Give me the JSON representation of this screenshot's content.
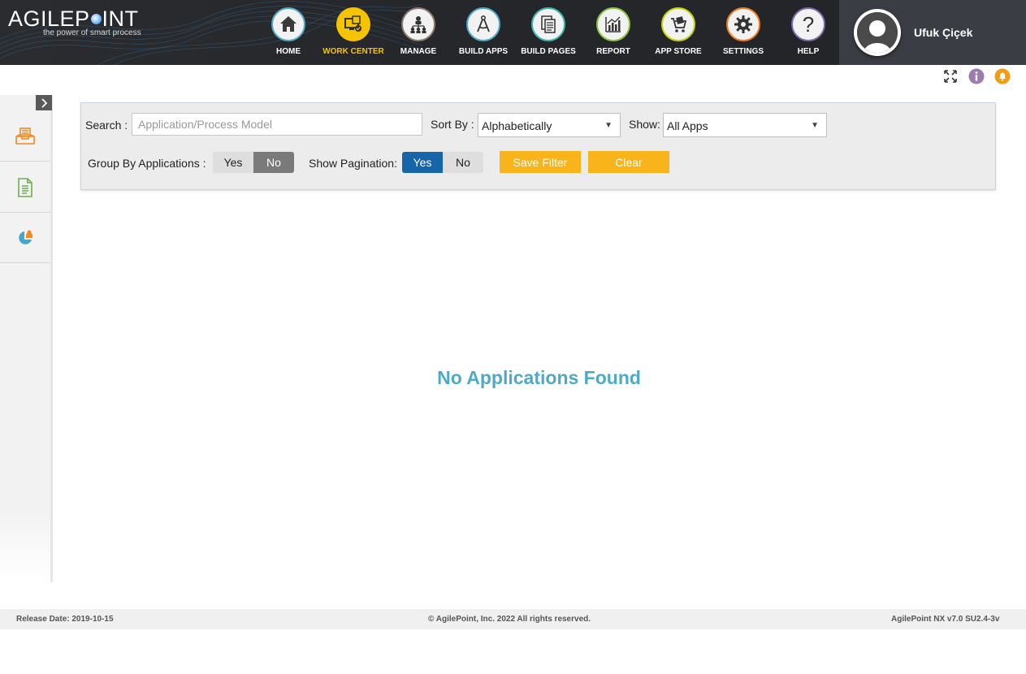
{
  "brand": {
    "name": "AGILEPOINT",
    "tagline": "the power of smart process"
  },
  "nav": [
    {
      "key": "home",
      "label": "HOME",
      "icon": "home-icon",
      "color": "#4eaac6"
    },
    {
      "key": "work-center",
      "label": "WORK CENTER",
      "icon": "work-center-icon",
      "color": "#f5c400",
      "active": true
    },
    {
      "key": "manage",
      "label": "MANAGE",
      "icon": "manage-icon",
      "color": "#8a7a6a"
    },
    {
      "key": "build-apps",
      "label": "BUILD APPS",
      "icon": "build-apps-icon",
      "color": "#4eaac6"
    },
    {
      "key": "build-pages",
      "label": "BUILD PAGES",
      "icon": "build-pages-icon",
      "color": "#3cb6b0"
    },
    {
      "key": "report",
      "label": "REPORT",
      "icon": "report-icon",
      "color": "#8cc63f"
    },
    {
      "key": "app-store",
      "label": "APP STORE",
      "icon": "app-store-icon",
      "color": "#c8d400"
    },
    {
      "key": "settings",
      "label": "SETTINGS",
      "icon": "settings-icon",
      "color": "#f07c1e"
    },
    {
      "key": "help",
      "label": "HELP",
      "icon": "help-icon",
      "color": "#7a6aa8"
    }
  ],
  "user": {
    "name": "Ufuk Çiçek"
  },
  "filter": {
    "search_label": "Search :",
    "search_placeholder": "Application/Process Model",
    "search_value": "",
    "sort_label": "Sort By :",
    "sort_value": "Alphabetically",
    "show_label": "Show:",
    "show_value": "All Apps",
    "group_label": "Group By Applications :",
    "group_yes": "Yes",
    "group_no": "No",
    "group_selected": "No",
    "pagination_label": "Show Pagination:",
    "pagination_yes": "Yes",
    "pagination_no": "No",
    "pagination_selected": "Yes",
    "save_label": "Save Filter",
    "clear_label": "Clear"
  },
  "main": {
    "empty_message": "No Applications Found"
  },
  "footer": {
    "release": "Release Date: 2019-10-15",
    "copyright": "© AgilePoint, Inc. 2022 All rights reserved.",
    "version": "AgilePoint NX v7.0 SU2.4-3v"
  },
  "colors": {
    "accent_orange": "#f9b41b",
    "accent_blue": "#1565a8",
    "empty_text": "#4eaac6"
  }
}
